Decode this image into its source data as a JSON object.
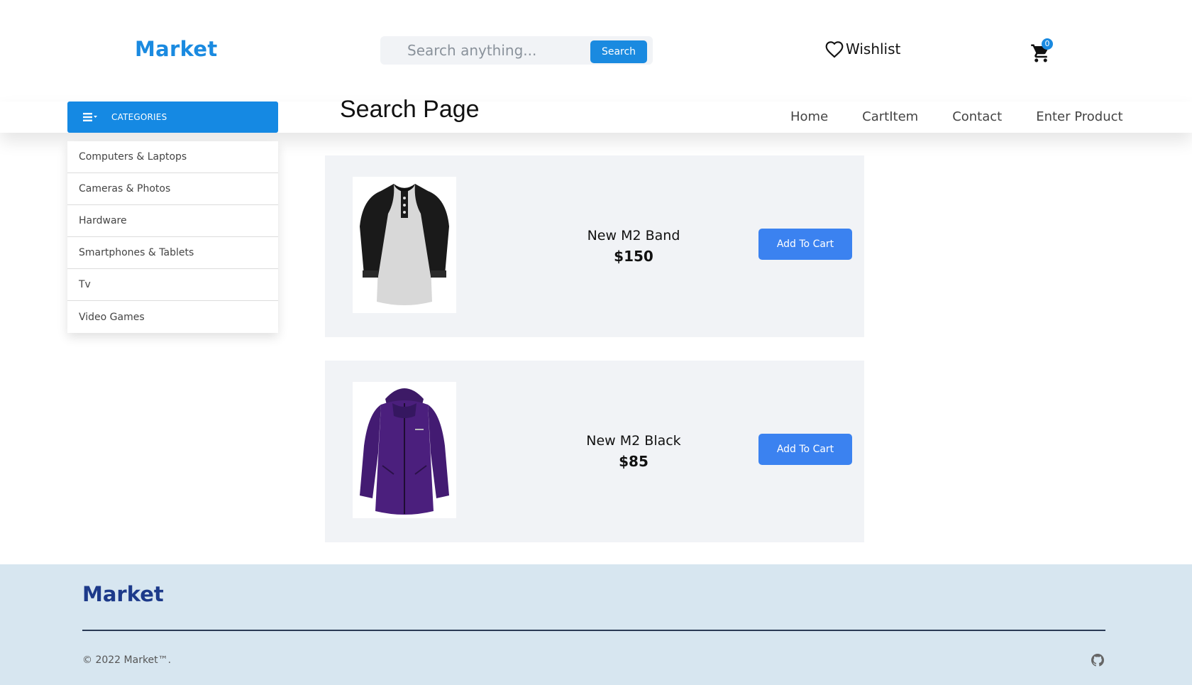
{
  "header": {
    "logo": "Market",
    "search": {
      "placeholder": "Search anything...",
      "button_label": "Search"
    },
    "wishlist_label": "Wishlist",
    "cart_count": "0"
  },
  "nav": {
    "categories_label": "CATEGORIES",
    "page_title": "Search Page",
    "links": [
      "Home",
      "CartItem",
      "Contact",
      "Enter Product"
    ]
  },
  "categories": [
    "Computers & Laptops",
    "Cameras & Photos",
    "Hardware",
    "Smartphones & Tablets",
    "Tv",
    "Video Games"
  ],
  "products": [
    {
      "name": "New M2 Band",
      "price": "$150",
      "button_label": "Add To Cart",
      "image": "raglan-shirt-icon"
    },
    {
      "name": "New M2 Black",
      "price": "$85",
      "button_label": "Add To Cart",
      "image": "purple-jacket-icon"
    }
  ],
  "footer": {
    "logo": "Market",
    "copyright": "© 2022 Market™.",
    "icon": "github-icon"
  },
  "colors": {
    "brand": "#1a8ae0",
    "button": "#3b82f0",
    "footer_bg": "#d7e6f0",
    "footer_logo": "#1d3a8a"
  }
}
